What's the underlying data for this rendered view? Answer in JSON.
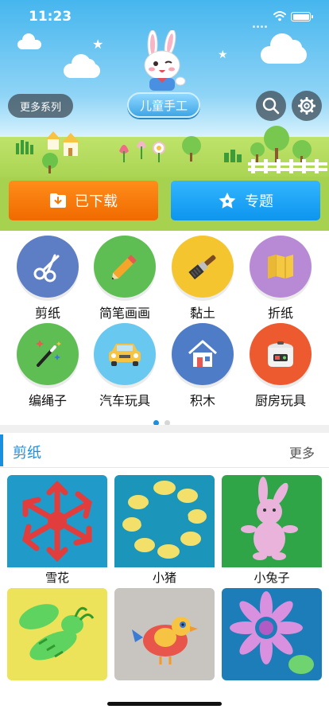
{
  "status_bar": {
    "time": "11:23"
  },
  "header": {
    "more_series_label": "更多系列",
    "title": "儿童手工",
    "search_icon": "search-icon",
    "settings_icon": "gear-icon"
  },
  "actions": {
    "downloaded_label": "已下载",
    "topic_label": "专题",
    "downloaded_color": "#f57a0a",
    "topic_color": "#1ba3f5"
  },
  "categories": [
    {
      "label": "剪纸",
      "icon": "scissors-icon",
      "color": "#5d7ec4"
    },
    {
      "label": "简笔画画",
      "icon": "pencil-icon",
      "color": "#5fbe53"
    },
    {
      "label": "黏土",
      "icon": "paintbrush-icon",
      "color": "#f5c52f"
    },
    {
      "label": "折纸",
      "icon": "folded-map-icon",
      "color": "#b88ad6"
    },
    {
      "label": "编绳子",
      "icon": "magic-wand-icon",
      "color": "#5fbe53"
    },
    {
      "label": "汽车玩具",
      "icon": "car-icon",
      "color": "#69c8f0"
    },
    {
      "label": "积木",
      "icon": "house-icon",
      "color": "#4f7cc7"
    },
    {
      "label": "厨房玩具",
      "icon": "rice-cooker-icon",
      "color": "#ee5a2f"
    }
  ],
  "pager": {
    "current": 1,
    "total": 2,
    "active_color": "#1a8fe0"
  },
  "section": {
    "title": "剪纸",
    "more_label": "更多",
    "accent": "#1a8fe0",
    "items": [
      {
        "caption": "雪花"
      },
      {
        "caption": "小猪"
      },
      {
        "caption": "小兔子"
      },
      {
        "caption": ""
      },
      {
        "caption": ""
      },
      {
        "caption": ""
      }
    ]
  }
}
